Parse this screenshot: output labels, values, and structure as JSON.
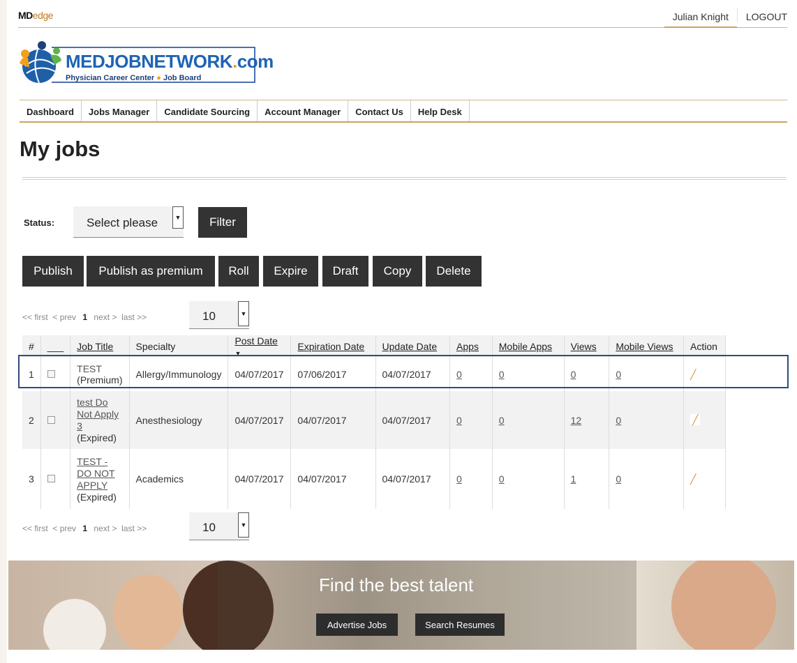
{
  "brand": {
    "name_main": "MD",
    "name_tail": "edge"
  },
  "user": {
    "name": "Julian Knight",
    "logout": "LOGOUT"
  },
  "logo": {
    "title_a": "MEDJOBNETWORK",
    "title_dot": ".",
    "title_b": "com",
    "subtitle_a": "Physician Career Center",
    "subtitle_dot": "●",
    "subtitle_b": "Job Board"
  },
  "nav": [
    "Dashboard",
    "Jobs Manager",
    "Candidate Sourcing",
    "Account Manager",
    "Contact Us",
    "Help Desk"
  ],
  "page_title": "My jobs",
  "filter": {
    "status_label": "Status:",
    "select_value": "Select please",
    "filter_button": "Filter"
  },
  "actions": [
    "Publish",
    "Publish as premium",
    "Roll",
    "Expire",
    "Draft",
    "Copy",
    "Delete"
  ],
  "pager": {
    "first": "<< first",
    "prev": "< prev",
    "current": "1",
    "next": "next >",
    "last": "last >>",
    "per_page": "10"
  },
  "table": {
    "headers": [
      "#",
      "___",
      "Job Title",
      "Specialty",
      "Post Date",
      "Expiration Date",
      "Update Date",
      "Apps",
      "Mobile Apps",
      "Views",
      "Mobile Views",
      "Action"
    ],
    "sort_indicator": "▼",
    "rows": [
      {
        "n": "1",
        "title": "TEST",
        "state": "(Premium)",
        "specialty": "Allergy/Immunology",
        "post": "04/07/2017",
        "expire": "07/06/2017",
        "update": "04/07/2017",
        "apps": "0",
        "mobile_apps": "0",
        "views": "0",
        "mobile_views": "0"
      },
      {
        "n": "2",
        "title": "test Do Not Apply 3",
        "state": "(Expired)",
        "specialty": "Anesthesiology",
        "post": "04/07/2017",
        "expire": "04/07/2017",
        "update": "04/07/2017",
        "apps": "0",
        "mobile_apps": "0",
        "views": "12",
        "mobile_views": "0"
      },
      {
        "n": "3",
        "title": "TEST - DO NOT APPLY",
        "state": "(Expired)",
        "specialty": "Academics",
        "post": "04/07/2017",
        "expire": "04/07/2017",
        "update": "04/07/2017",
        "apps": "0",
        "mobile_apps": "0",
        "views": "1",
        "mobile_views": "0"
      }
    ]
  },
  "banner": {
    "title": "Find the best talent",
    "advertise": "Advertise Jobs",
    "search": "Search Resumes"
  },
  "icons": {
    "select_arrow": "caret-down-icon",
    "edit": "pencil-icon",
    "checkbox": "checkbox-icon"
  }
}
